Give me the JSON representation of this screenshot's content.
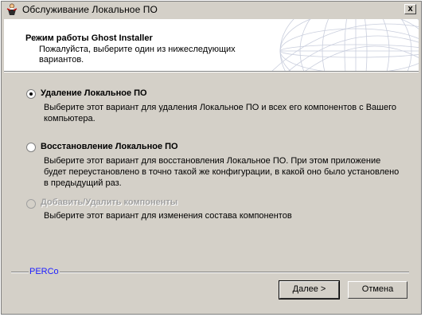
{
  "window": {
    "title": "Обслуживание Локальное ПО",
    "close_label": "x"
  },
  "header": {
    "title": "Режим работы Ghost Installer",
    "subtitle": "Пожалуйста, выберите один из нижеследующих вариантов."
  },
  "options": [
    {
      "label": "Удаление Локальное ПО",
      "description": "Выберите этот вариант для удаления Локальное ПО и всех его компонентов с Вашего компьютера.",
      "selected": true,
      "enabled": true
    },
    {
      "label": "Восстановление Локальное ПО",
      "description": "Выберите этот вариант для восстановления Локальное ПО. При этом приложение будет переустановлено в точно такой же конфигурации, в какой оно было установлено в предыдущий раз.",
      "selected": false,
      "enabled": true
    },
    {
      "label": "Добавить/Удалить компоненты",
      "description": "Выберите этот вариант для изменения состава компонентов",
      "selected": false,
      "enabled": false
    }
  ],
  "footer": {
    "brand": "PERCo",
    "next_label": "Далее >",
    "cancel_label": "Отмена"
  },
  "colors": {
    "face": "#d4d0c8",
    "brand": "#1c1cff",
    "disabled_text": "#a0a0a0"
  },
  "icons": {
    "app": "installer-figure-icon",
    "header_graphic": "globe-wireframe-icon"
  }
}
